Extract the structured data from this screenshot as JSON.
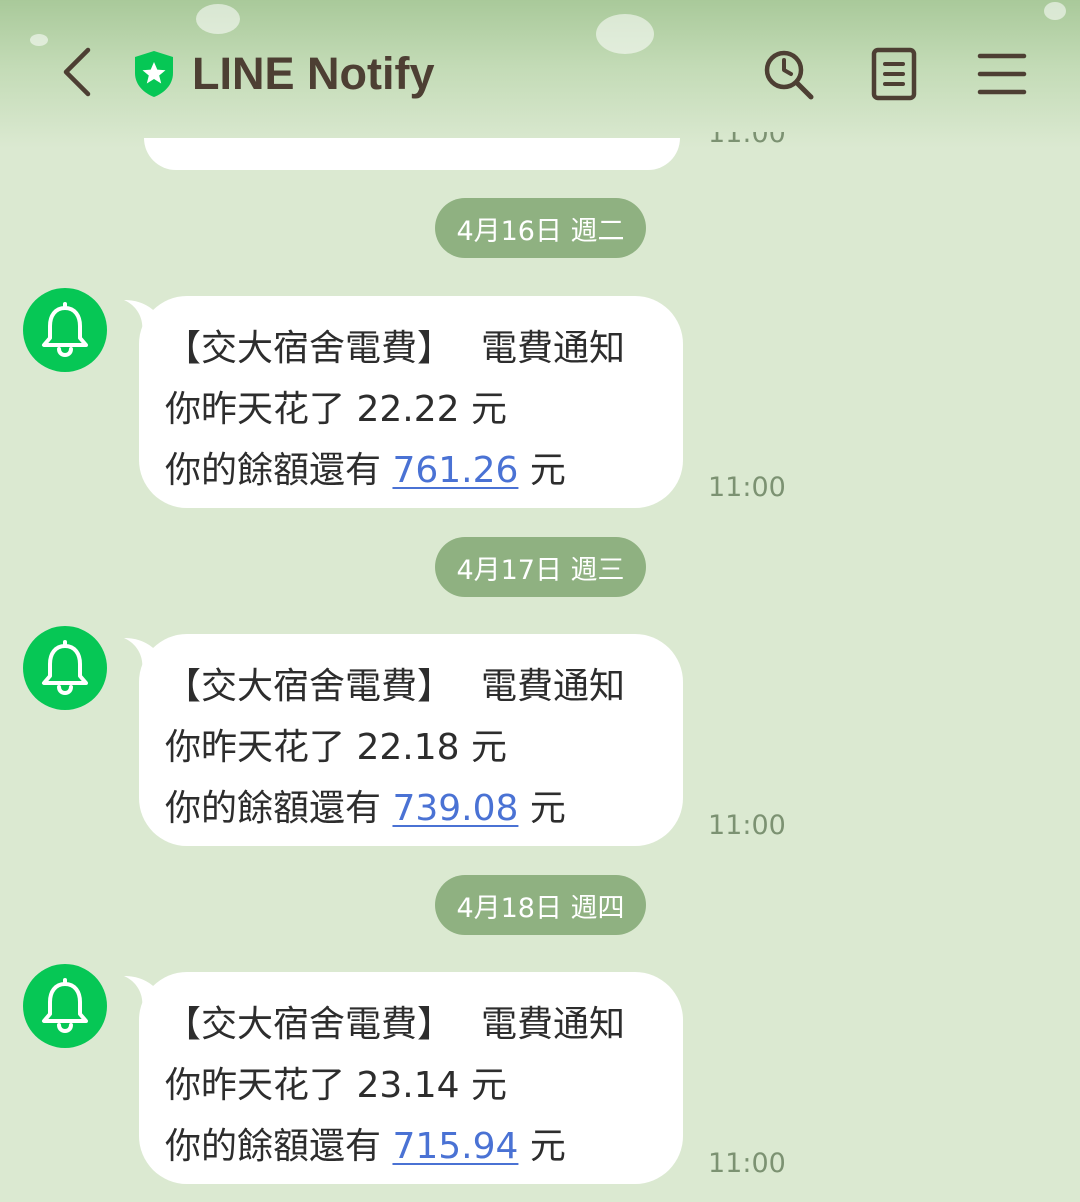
{
  "header": {
    "title": "LINE Notify",
    "icons": {
      "back": "back-arrow-icon",
      "shield": "shield-star-icon",
      "search": "search-icon",
      "notes": "notes-icon",
      "menu": "menu-icon"
    }
  },
  "colors": {
    "background": "#dbe9d1",
    "date_pill": "#8fb181",
    "avatar": "#06c755",
    "link": "#4a72d4",
    "title": "#4d3f33"
  },
  "top_partial_time": "11:00",
  "messages": [
    {
      "date": "4月16日 週二",
      "title": "【交大宿舍電費】",
      "subtitle": "電費通知",
      "spent_prefix": "你昨天花了",
      "spent": "22.22",
      "unit": "元",
      "balance_prefix": "你的餘額還有",
      "balance": "761.26",
      "time": "11:00"
    },
    {
      "date": "4月17日 週三",
      "title": "【交大宿舍電費】",
      "subtitle": "電費通知",
      "spent_prefix": "你昨天花了",
      "spent": "22.18",
      "unit": "元",
      "balance_prefix": "你的餘額還有",
      "balance": "739.08",
      "time": "11:00"
    },
    {
      "date": "4月18日 週四",
      "title": "【交大宿舍電費】",
      "subtitle": "電費通知",
      "spent_prefix": "你昨天花了",
      "spent": "23.14",
      "unit": "元",
      "balance_prefix": "你的餘額還有",
      "balance": "715.94",
      "time": "11:00"
    }
  ]
}
